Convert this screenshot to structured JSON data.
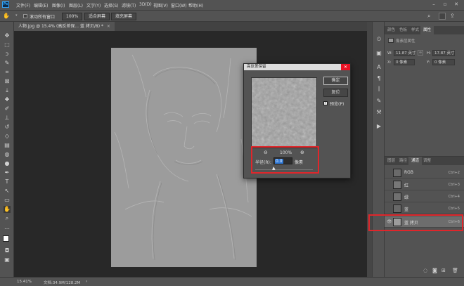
{
  "menubar": {
    "logo": "Ps",
    "items": [
      "文件(F)",
      "编辑(E)",
      "图像(I)",
      "图层(L)",
      "文字(Y)",
      "选择(S)",
      "滤镜(T)",
      "3D(D)",
      "视图(V)",
      "窗口(W)",
      "帮助(H)"
    ]
  },
  "options": {
    "checkbox_label": "滚动所有窗口",
    "zoom_button": "100%",
    "fit_button": "适合屏幕",
    "fill_button": "填充屏幕"
  },
  "document_tab": {
    "label": "人物.jpg @ 15.4% (高反差保... 蓝 拷贝/8) *"
  },
  "status": {
    "zoom": "15.41%",
    "doc_size": "文档:34.9M/128.2M"
  },
  "dialog": {
    "title": "高反差保留",
    "ok": "确定",
    "reset": "复位",
    "preview_checkbox": "预览(P)",
    "zoom_level": "100%",
    "radius_label": "半径(R):",
    "radius_value": "0.0",
    "radius_unit": "像素",
    "preview_checked": true,
    "radius_slider": 0.0
  },
  "properties_panel": {
    "tabs": [
      "颜色",
      "色板",
      "样式",
      "属性"
    ],
    "active_tab": "属性",
    "subtitle": "像素层属性",
    "width_label": "W:",
    "width_value": "11.87 英寸",
    "height_label": "H:",
    "height_value": "17.87 英寸",
    "x_label": "X:",
    "x_value": "0 像素",
    "y_label": "Y:",
    "y_value": "0 像素"
  },
  "channels_panel": {
    "tabs": [
      "图层",
      "路径",
      "通道",
      "调整"
    ],
    "active_tab": "通道",
    "rows": [
      {
        "name": "RGB",
        "shortcut": "Ctrl+2"
      },
      {
        "name": "红",
        "shortcut": "Ctrl+3"
      },
      {
        "name": "绿",
        "shortcut": "Ctrl+4"
      },
      {
        "name": "蓝",
        "shortcut": "Ctrl+5"
      },
      {
        "name": "蓝 拷贝",
        "shortcut": "Ctrl+6"
      }
    ]
  },
  "colors": {
    "highlight_red": "#e0262b",
    "ps_blue": "#31a8ff",
    "close_red": "#e81123"
  }
}
